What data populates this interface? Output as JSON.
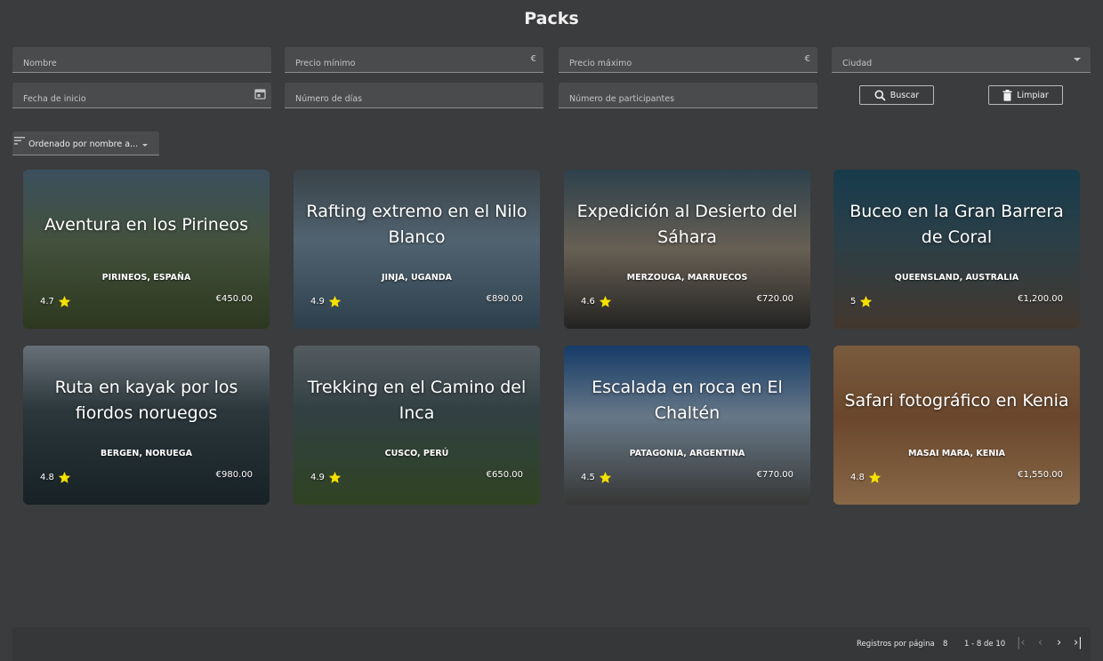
{
  "page": {
    "title": "Packs"
  },
  "filters": {
    "nombre": "Nombre",
    "precio_minimo": "Precio mínimo",
    "precio_maximo": "Precio máximo",
    "currency": "€",
    "ciudad": "Ciudad",
    "fecha_inicio": "Fecha de inicio",
    "numero_dias": "Número de días",
    "numero_participantes": "Número de participantes",
    "buscar": "Buscar",
    "limpiar": "Limpiar"
  },
  "sort": {
    "label": "Ordenado por nombre a..."
  },
  "cards": [
    {
      "title": "Aventura en los Pirineos",
      "location": "PIRINEOS, ESPAÑA",
      "rating": "4.7",
      "price": "€450.00"
    },
    {
      "title": "Rafting extremo en el Nilo Blanco",
      "location": "JINJA, UGANDA",
      "rating": "4.9",
      "price": "€890.00"
    },
    {
      "title": "Expedición al Desierto del Sáhara",
      "location": "MERZOUGA, MARRUECOS",
      "rating": "4.6",
      "price": "€720.00"
    },
    {
      "title": "Buceo en la Gran Barrera de Coral",
      "location": "QUEENSLAND, AUSTRALIA",
      "rating": "5",
      "price": "€1,200.00"
    },
    {
      "title": "Ruta en kayak por los fiordos noruegos",
      "location": "BERGEN, NORUEGA",
      "rating": "4.8",
      "price": "€980.00"
    },
    {
      "title": "Trekking en el Camino del Inca",
      "location": "CUSCO, PERÚ",
      "rating": "4.9",
      "price": "€650.00"
    },
    {
      "title": "Escalada en roca en El Chaltén",
      "location": "PATAGONIA, ARGENTINA",
      "rating": "4.5",
      "price": "€770.00"
    },
    {
      "title": "Safari fotográfico en Kenia",
      "location": "MASAI MARA, KENIA",
      "rating": "4.8",
      "price": "€1,550.00"
    }
  ],
  "pagination": {
    "label": "Registros por página",
    "page_size": "8",
    "range": "1 - 8 de 10"
  },
  "colors": {
    "background": "#3b3c3e",
    "star": "#f5e100"
  },
  "icons": {
    "star": "star-icon",
    "search": "search-icon",
    "trash": "trash-icon",
    "calendar": "calendar-icon",
    "sort": "sort-icon"
  }
}
